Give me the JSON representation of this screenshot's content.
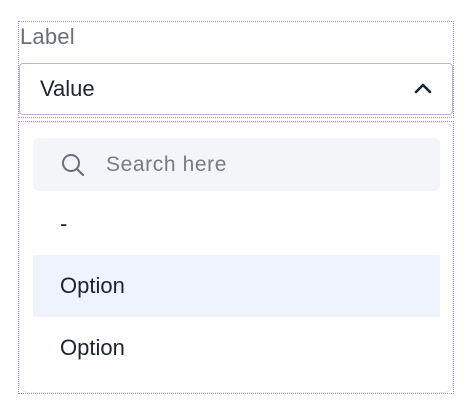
{
  "field": {
    "label": "Label",
    "value": "Value",
    "chevron_icon": "chevron-up-icon"
  },
  "dropdown": {
    "search": {
      "placeholder": "Search here",
      "value": "",
      "icon": "search-icon"
    },
    "options": [
      {
        "label": "-",
        "highlighted": false
      },
      {
        "label": "Option",
        "highlighted": true
      },
      {
        "label": "Option",
        "highlighted": false
      }
    ]
  },
  "colors": {
    "frame_dotted": "#a58ae0",
    "select_border": "#b9b3d9",
    "highlight_bg": "#eff3fd",
    "search_bg": "#f4f5f8",
    "text_primary": "#1f2330",
    "text_label": "#6b6f7a"
  }
}
